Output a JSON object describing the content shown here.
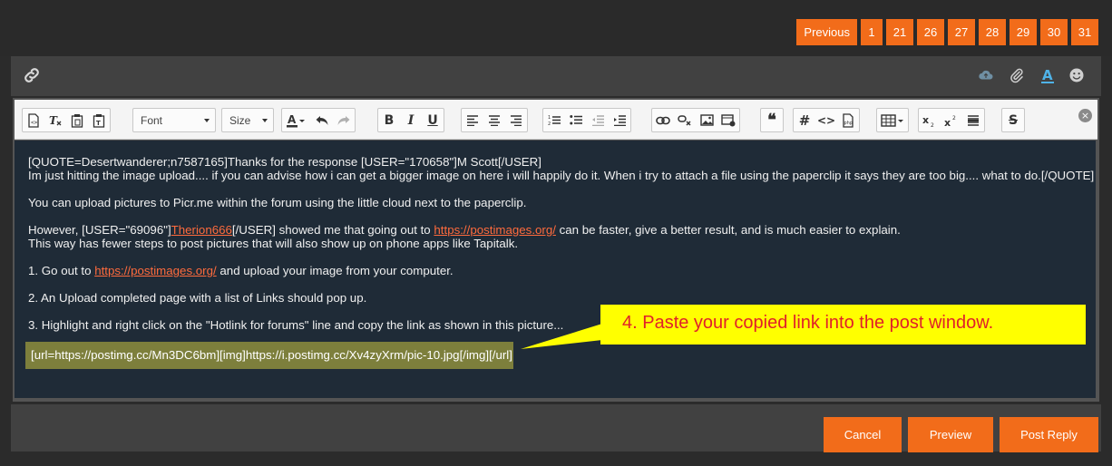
{
  "pagination": {
    "previous_label": "Previous",
    "pages": [
      "1",
      "21",
      "26",
      "27",
      "28",
      "29",
      "30",
      "31"
    ]
  },
  "editor_bar": {
    "left_icon": "link-icon",
    "right_icons": [
      "cloud-upload-icon",
      "paperclip-icon",
      "text-color-icon",
      "smiley-icon"
    ]
  },
  "toolbar": {
    "font_placeholder": "Font",
    "size_placeholder": "Size",
    "bold": "B",
    "italic": "I",
    "underline": "U",
    "quote": "❝",
    "hash": "#",
    "code": "<>",
    "strike": "S"
  },
  "post": {
    "line1": "[QUOTE=Desertwanderer;n7587165]Thanks for the response [USER=\"170658\"]M Scott[/USER]",
    "line2": "Im just hitting the image upload.... if you can advise how i can get a bigger image on here i will happily do it. When i try to attach a file using the paperclip it says they are too big.... what to do.[/QUOTE]",
    "line3": "You can upload pictures to Picr.me within the forum using the little cloud next to the paperclip.",
    "line4_pre": "However, [USER=\"69096\"]",
    "line4_user": "Therion666",
    "line4_mid": "[/USER] showed me that going out to ",
    "line4_link": "https://postimages.org/",
    "line4_post": " can be faster, give a better result, and is much easier to explain.",
    "line5": "This way has fewer steps to post pictures that will also show up on phone apps like Tapitalk.",
    "line6_pre": "1. Go out to ",
    "line6_link": "https://postimages.org/",
    "line6_post": " and upload your image from your computer.",
    "line7": "2. An Upload completed page with a list of Links should pop up.",
    "line8": "3. Highlight and right click on the \"Hotlink for forums\" line and copy the link as shown in this picture...",
    "highlighted_link": "[url=https://postimg.cc/Mn3DC6bm][img]https://i.postimg.cc/Xv4zyXrm/pic-10.jpg[/img][/url]"
  },
  "callout": {
    "text": "4. Paste your copied link into the post window.",
    "bg_color": "#ffff00",
    "text_color": "#e0202a"
  },
  "actions": {
    "cancel": "Cancel",
    "preview": "Preview",
    "post_reply": "Post Reply"
  },
  "colors": {
    "accent": "#f26c1a",
    "editor_bg": "#1f2b37"
  }
}
